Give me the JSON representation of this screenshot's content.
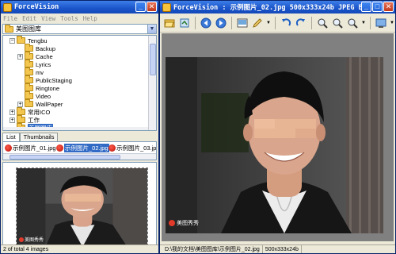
{
  "left_window": {
    "title": "ForceVision",
    "menu": [
      "File",
      "Edit",
      "View",
      "Tools",
      "Help"
    ],
    "path_combo": "美图图库",
    "tree": [
      {
        "label": "Tengbu",
        "expander": "−",
        "depth": 1
      },
      {
        "label": "Backup",
        "expander": "",
        "depth": 2
      },
      {
        "label": "Cache",
        "expander": "+",
        "depth": 2
      },
      {
        "label": "Lyrics",
        "expander": "",
        "depth": 2
      },
      {
        "label": "mv",
        "expander": "",
        "depth": 2
      },
      {
        "label": "PublicStaging",
        "expander": "",
        "depth": 2
      },
      {
        "label": "Ringtone",
        "expander": "",
        "depth": 2
      },
      {
        "label": "Video",
        "expander": "",
        "depth": 2
      },
      {
        "label": "WallPaper",
        "expander": "+",
        "depth": 2
      },
      {
        "label": "常用ICO",
        "expander": "+",
        "depth": 1
      },
      {
        "label": "工作",
        "expander": "+",
        "depth": 1
      },
      {
        "label": "美图图库",
        "expander": "",
        "depth": 1,
        "selected": true
      }
    ],
    "tabs": [
      "List",
      "Thumbnails"
    ],
    "files": [
      {
        "label": "示例图片_01.jpg"
      },
      {
        "label": "示例图片_02.jpg",
        "selected": true
      },
      {
        "label": "示例图片_03.jpg"
      }
    ],
    "preview_watermark": "美图秀秀",
    "status": "2 of total 4 images"
  },
  "right_window": {
    "title": "ForceVision : 示例图片_02.jpg   500x333x24b   JPEG Bi...",
    "watermark": "美图秀秀",
    "status": {
      "path": "D:\\我的文档\\美图图库\\示例图片_02.jpg",
      "dims": "500x333x24b"
    }
  },
  "colors": {
    "titlebar": "#1a55c9",
    "selection": "#316ac5",
    "viewer_bg": "#808080",
    "folder": "#f2c64f"
  }
}
